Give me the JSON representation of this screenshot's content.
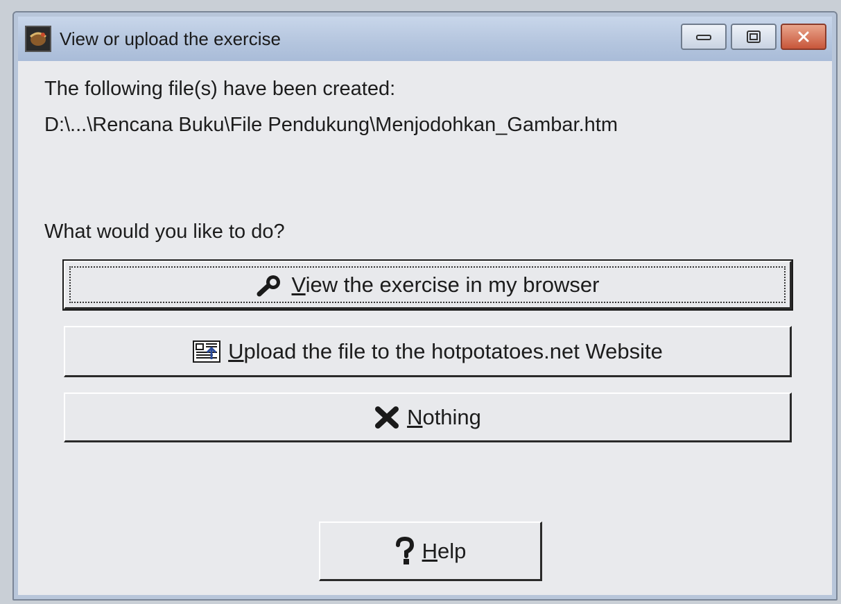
{
  "window": {
    "title": "View or upload the exercise",
    "controls": [
      "minimize-icon",
      "maximize-icon",
      "close-icon"
    ]
  },
  "message": {
    "created_line": "The following file(s) have been created:",
    "file_path": "D:\\...\\Rencana Buku\\File Pendukung\\Menjodohkan_Gambar.htm",
    "question": "What would you like to do?"
  },
  "buttons": {
    "view": {
      "mnemonic": "V",
      "rest": "iew the exercise in my browser",
      "icon": "magnifier-icon"
    },
    "upload": {
      "mnemonic": "U",
      "rest": "pload the file to the hotpotatoes.net Website",
      "icon": "upload-icon"
    },
    "nothing": {
      "mnemonic": "N",
      "rest": "othing",
      "icon": "x-icon"
    },
    "help": {
      "mnemonic": "H",
      "rest": "elp",
      "icon": "question-icon"
    }
  },
  "colors": {
    "titlebar": "#b4c5de",
    "close_button": "#c8563a",
    "nothing_icon": "#1a1a1a"
  }
}
